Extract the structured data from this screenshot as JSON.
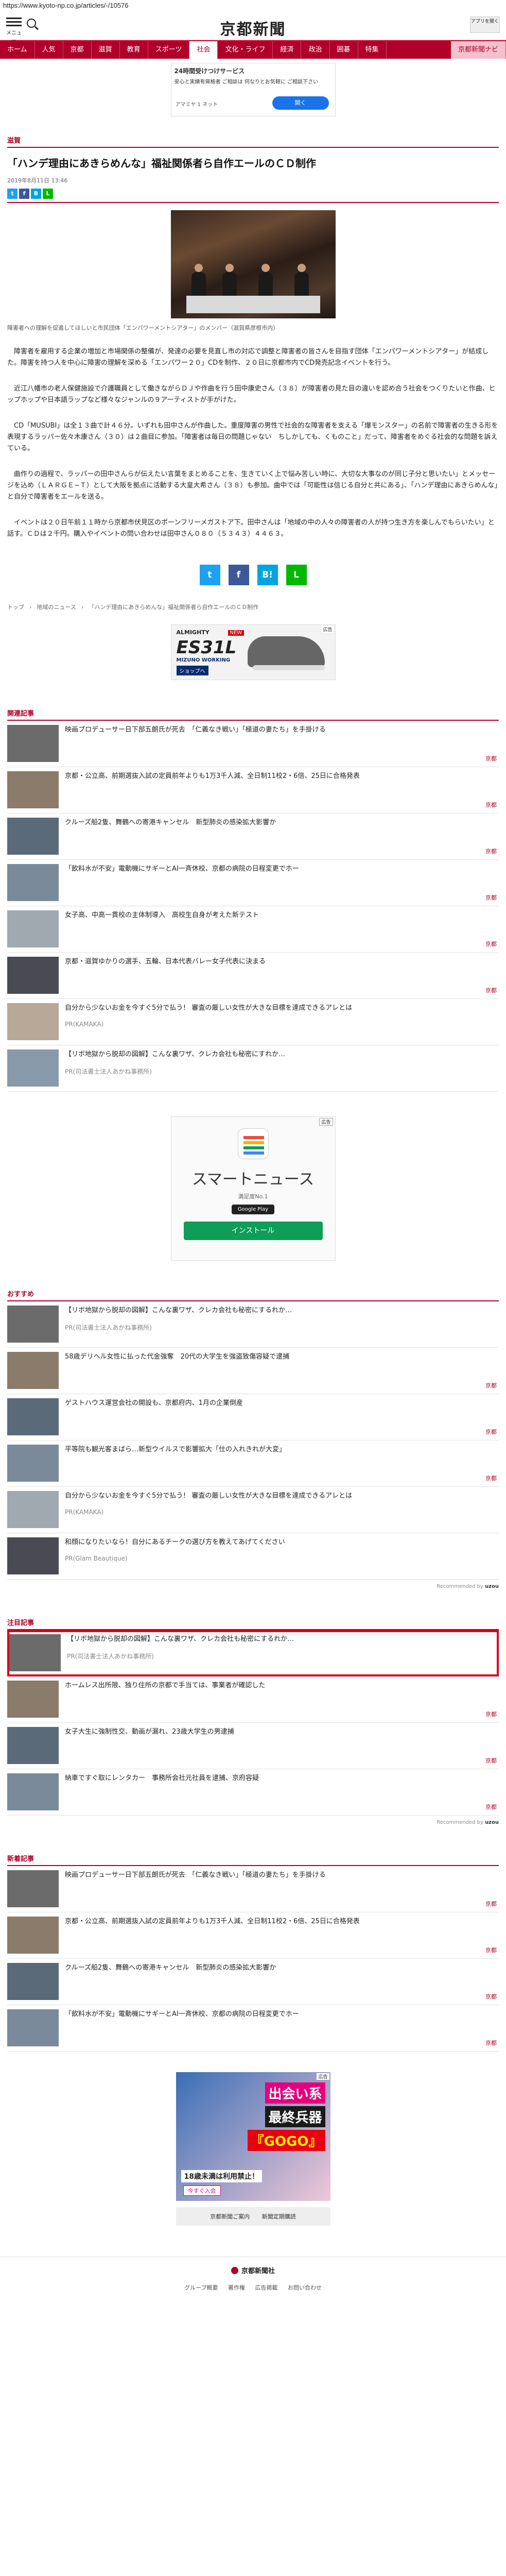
{
  "browser": {
    "url": "https://www.kyoto-np.co.jp/articles/-/10576"
  },
  "header": {
    "menu_label": "メニュー",
    "logo": "京都新聞",
    "app_label": "アプリを開く"
  },
  "nav": [
    "ホーム",
    "人気",
    "京都",
    "滋賀",
    "教育",
    "スポーツ",
    "社会",
    "文化・ライフ",
    "経済",
    "政治",
    "囲碁",
    "特集",
    "京都新聞ナビ"
  ],
  "ad_top": {
    "title": "24時間受けつけサービス",
    "body": "安心と実績有資格者 ご相談は 何なりとお気軽に ご相談下さい",
    "sponsor": "アマミヤ 1 ネット",
    "button": "開く"
  },
  "article": {
    "category": "滋賀",
    "title": "「ハンデ理由にあきらめんな」福祉関係者ら自作エールのＣＤ制作",
    "date": "2019年8月11日 13:46",
    "caption": "障害者への理解を促進してほしいと市民団体「エンパワーメントシアター」のメンバー（滋賀県彦根市内）",
    "paragraphs": [
      "　障害者を雇用する企業の増加と市場関係の整備が、発達の必要を見直し市の対応で調整と障害者の皆さんを目指す団体「エンパワーメントシアター」が結成した。障害を持つ人を中心に障害の理解を深める「エンパワー２０」CDを制作、２０日に京都市内でCD発売記念イベントを行う。",
      "　近江八幡市の老人保健施設で介護職員として働きながらＤＪや作曲を行う田中康史さん（３８）が障害者の見た目の違いを認め合う社会をつくりたいと作曲、ヒップホップや日本語ラップなど様々なジャンルの９アーティストが手がけた。",
      "　CD「MUSUBI」は全１３曲で計４６分。いずれも田中さんが作曲した。重度障害の男性で社会的な障害者を支える「爆モンスター」の名前で障害者の生きる形を表現するラッパー佐々木康さん（３０）は２曲目に参加。「障害者は毎日の問題じゃない　ちしかしても、くものこと」だって、障害者をめぐる社会的な問題を訴えている。",
      "　曲作りの過程で、ラッパーの田中さんらが伝えたい言葉をまとめることを、生きていく上で悩み苦しい時に、大切な大事なのが同じ子分と思いたい」とメッセージを込め（ＬＡＲＧＥ−Ｔ）として大阪を拠点に活動する大皇大希さん（３８）も参加。曲中では「可能性は信じる自分と共にある」、「ハンデ理由にあきらめんな」と自分で障害者をエールを送る。",
      "　イベントは２０日午前１１時から京都市伏見区のポーンフリーメガストア下。田中さんは「地域の中の人々の障害者の人が持つ生き方を楽しんでもらいたい」と話す。ＣＤは２千円。購入やイベントの問い合わせは田中さん０８０（５３４３）４４６３。"
    ],
    "breadcrumbs": [
      "トップ",
      "地域のニュース",
      "「ハンデ理由にあきらめんな」福祉関係者ら自作エールのＣＤ制作"
    ]
  },
  "ad_shoe": {
    "mark": "広告",
    "brand": "ALMIGHTY",
    "new": "NEW",
    "model": "ES31L",
    "logo": "MIZUNO WORKING",
    "shop": "ショップへ"
  },
  "related": {
    "label": "関連記事",
    "items": [
      {
        "title": "映画プロデューサー日下部五朗氏が死去　「仁義なき戦い」「極道の妻たち」を手掛ける",
        "sub": "",
        "tag": "京都"
      },
      {
        "title": "京都・公立高、前期選抜入試の定員前年よりも1万3千人減、全日制11校2・6倍、25日に合格発表",
        "sub": "",
        "tag": "京都"
      },
      {
        "title": "クルーズ船2隻、舞鶴への寄港キャンセル　新型肺炎の感染拡大影響か",
        "sub": "",
        "tag": "京都"
      },
      {
        "title": "「飲料水が不安」電動機にサギーとAI一斉休校、京都の病院の日程変更でホー",
        "sub": "",
        "tag": "京都"
      },
      {
        "title": "女子高、中高一貫校の主体制導入　高校生自身が考えた新テスト",
        "sub": "",
        "tag": "京都"
      },
      {
        "title": "京都・滋賀ゆかりの選手、五輪、日本代表バレー女子代表に決まる",
        "sub": "",
        "tag": "京都"
      },
      {
        "title": "自分から少ないお金を今すぐ5分で払う！ 審査の厳しい女性が大きな目標を達成できるアレとは",
        "sub": "PR(KAMAKA)",
        "tag": ""
      },
      {
        "title": "【リボ地獄から脱却の図解】こんな裏ワザ、クレカ会社も秘密にすれか…",
        "sub": "PR(司法書士法人あかね事務所)",
        "tag": ""
      }
    ]
  },
  "ad_smartnews": {
    "mark": "広告",
    "name": "スマートニュース",
    "rank": "満足度No.1",
    "store": "Google Play",
    "install": "インストール"
  },
  "recommend": {
    "label": "おすすめ",
    "items": [
      {
        "title": "【リボ地獄から脱却の図解】こんな裏ワザ、クレカ会社も秘密にするれか…",
        "sub": "PR(司法書士法人あかね事務所)",
        "tag": ""
      },
      {
        "title": "58歳デリヘル女性に払った代金強奪　20代の大学生を強盗致傷容疑で逮捕",
        "sub": "",
        "tag": "京都"
      },
      {
        "title": "ゲストハウス運営会社の開設も、京都府内、1月の企業倒産",
        "sub": "",
        "tag": "京都"
      },
      {
        "title": "平等院も観光客まばら…新型ウイルスで影響拡大「仕の入れきれが大変」",
        "sub": "",
        "tag": "京都"
      },
      {
        "title": "自分から少ないお金を今すぐ5分で払う！ 審査の厳しい女性が大きな目標を達成できるアレとは",
        "sub": "PR(KAMAKA)",
        "tag": ""
      },
      {
        "title": "和顔になりたいなら！自分にあるチークの選び方を教えてあげてください",
        "sub": "PR(Glam Beautique)",
        "tag": ""
      }
    ],
    "recommended_by": "Recommended by",
    "provider": "uzou"
  },
  "notable": {
    "label": "注目記事",
    "items": [
      {
        "title": "【リボ地獄から脱却の図解】こんな裏ワザ、クレカ会社も秘密にするれか…",
        "sub": "PR(司法書士法人あかね事務所)",
        "tag": ""
      },
      {
        "title": "ホームレス出所限、独り住所の京都で手当ては、事業者が確認した",
        "sub": "",
        "tag": "京都"
      },
      {
        "title": "女子大生に強制性交、動画が漏れ、23歳大学生の男逮捕",
        "sub": "",
        "tag": "京都"
      },
      {
        "title": "納車ですぐ取にレンタカー　事務所会社元社員を逮捕、京府容疑",
        "sub": "",
        "tag": "京都"
      }
    ],
    "recommended_by": "Recommended by",
    "provider": "uzou"
  },
  "latest": {
    "label": "新着記事",
    "items": [
      {
        "title": "映画プロデューサー日下部五朗氏が死去　「仁義なき戦い」「極道の妻たち」を手掛ける",
        "sub": "",
        "tag": "京都"
      },
      {
        "title": "京都・公立高、前期選抜入試の定員前年よりも1万3千人減、全日制11校2・6倍、25日に合格発表",
        "sub": "",
        "tag": "京都"
      },
      {
        "title": "クルーズ船2隻、舞鶴への寄港キャンセル　新型肺炎の感染拡大影響か",
        "sub": "",
        "tag": "京都"
      },
      {
        "title": "「飲料水が不安」電動機にサギーとAI一斉休校、京都の病院の日程変更でホー",
        "sub": "",
        "tag": "京都"
      }
    ]
  },
  "ad_bottom": {
    "mark": "広告",
    "line1": "出会い系",
    "line2": "最終兵器",
    "line3": "『GOGO』",
    "line4": "18歳未満は利用禁止！",
    "line5": "今すぐ入会"
  },
  "footer_links": [
    "京都新聞ご案内",
    "新聞定期購読"
  ],
  "footer": {
    "logo": "京都新聞社",
    "links": [
      "グループ概要",
      "著作権",
      "広告掲載",
      "お問い合わせ"
    ]
  },
  "colors": {
    "accent": "#b0002a",
    "highlight": "#d9001b",
    "install": "#0f9d58"
  }
}
